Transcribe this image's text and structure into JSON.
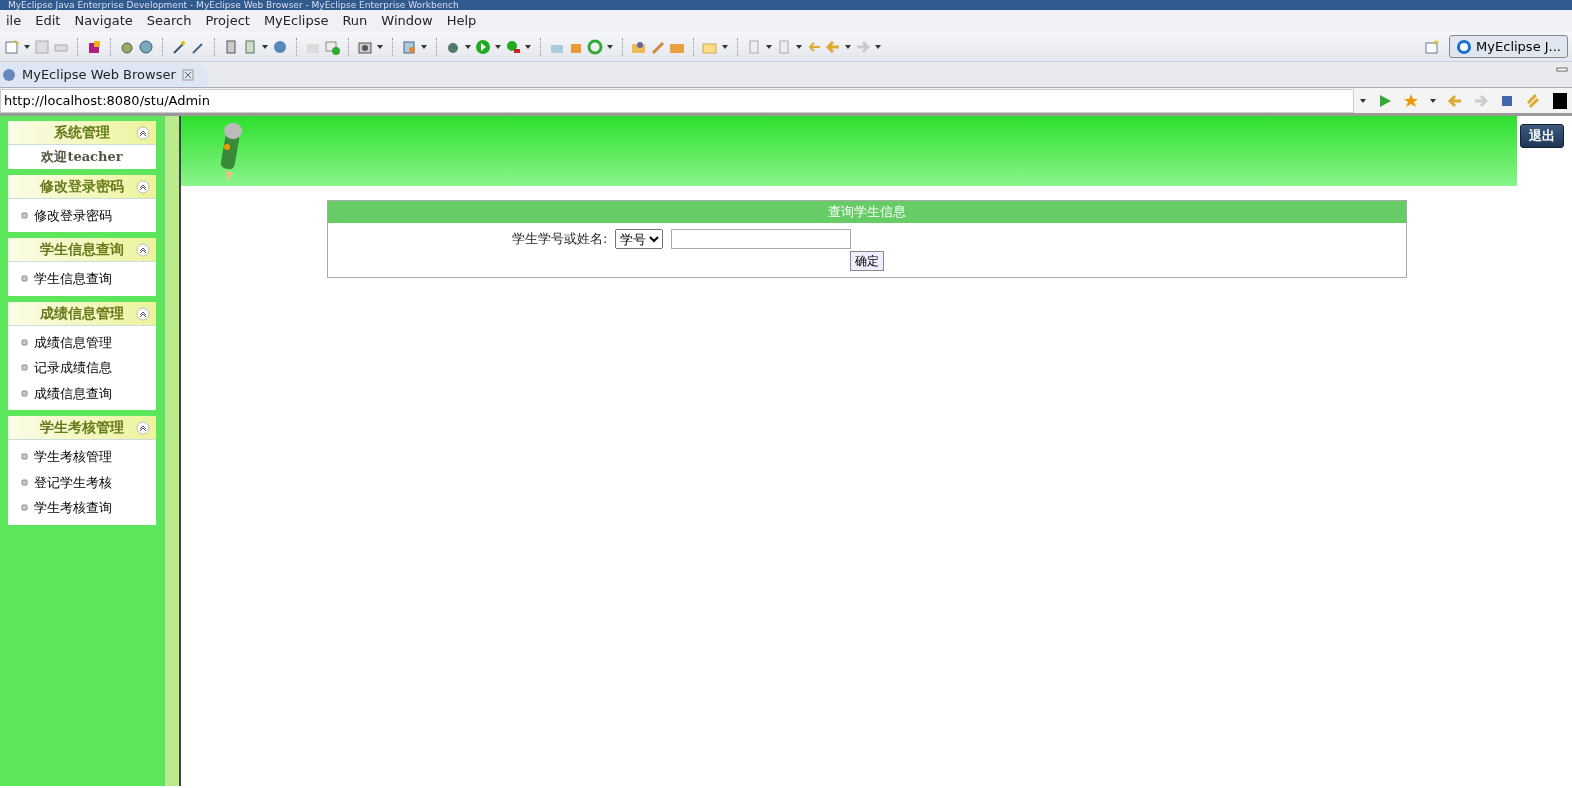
{
  "window": {
    "title": "MyEclipse Java Enterprise Development - MyEclipse Web Browser - MyEclipse Enterprise Workbench"
  },
  "menu": [
    "ile",
    "Edit",
    "Navigate",
    "Search",
    "Project",
    "MyEclipse",
    "Run",
    "Window",
    "Help"
  ],
  "perspective_button": "MyEclipse J...",
  "editor_tab": {
    "label": "MyEclipse Web Browser",
    "selected": true
  },
  "address_bar": {
    "value": "http://localhost:8080/stu/Admin"
  },
  "sidebar": {
    "sections": [
      {
        "title": "系统管理",
        "kind": "welcome",
        "items": [
          "欢迎teacher"
        ]
      },
      {
        "title": "修改登录密码",
        "kind": "links",
        "items": [
          "修改登录密码"
        ]
      },
      {
        "title": "学生信息查询",
        "kind": "links",
        "items": [
          "学生信息查询"
        ]
      },
      {
        "title": "成绩信息管理",
        "kind": "links",
        "items": [
          "成绩信息管理",
          "记录成绩信息",
          "成绩信息查询"
        ]
      },
      {
        "title": "学生考核管理",
        "kind": "links",
        "items": [
          "学生考核管理",
          "登记学生考核",
          "学生考核查询"
        ]
      }
    ]
  },
  "header": {
    "logout_button": "退出"
  },
  "query_panel": {
    "title": "查询学生信息",
    "label": "学生学号或姓名:",
    "select": {
      "value": "学号"
    },
    "submit_button": "确定"
  }
}
